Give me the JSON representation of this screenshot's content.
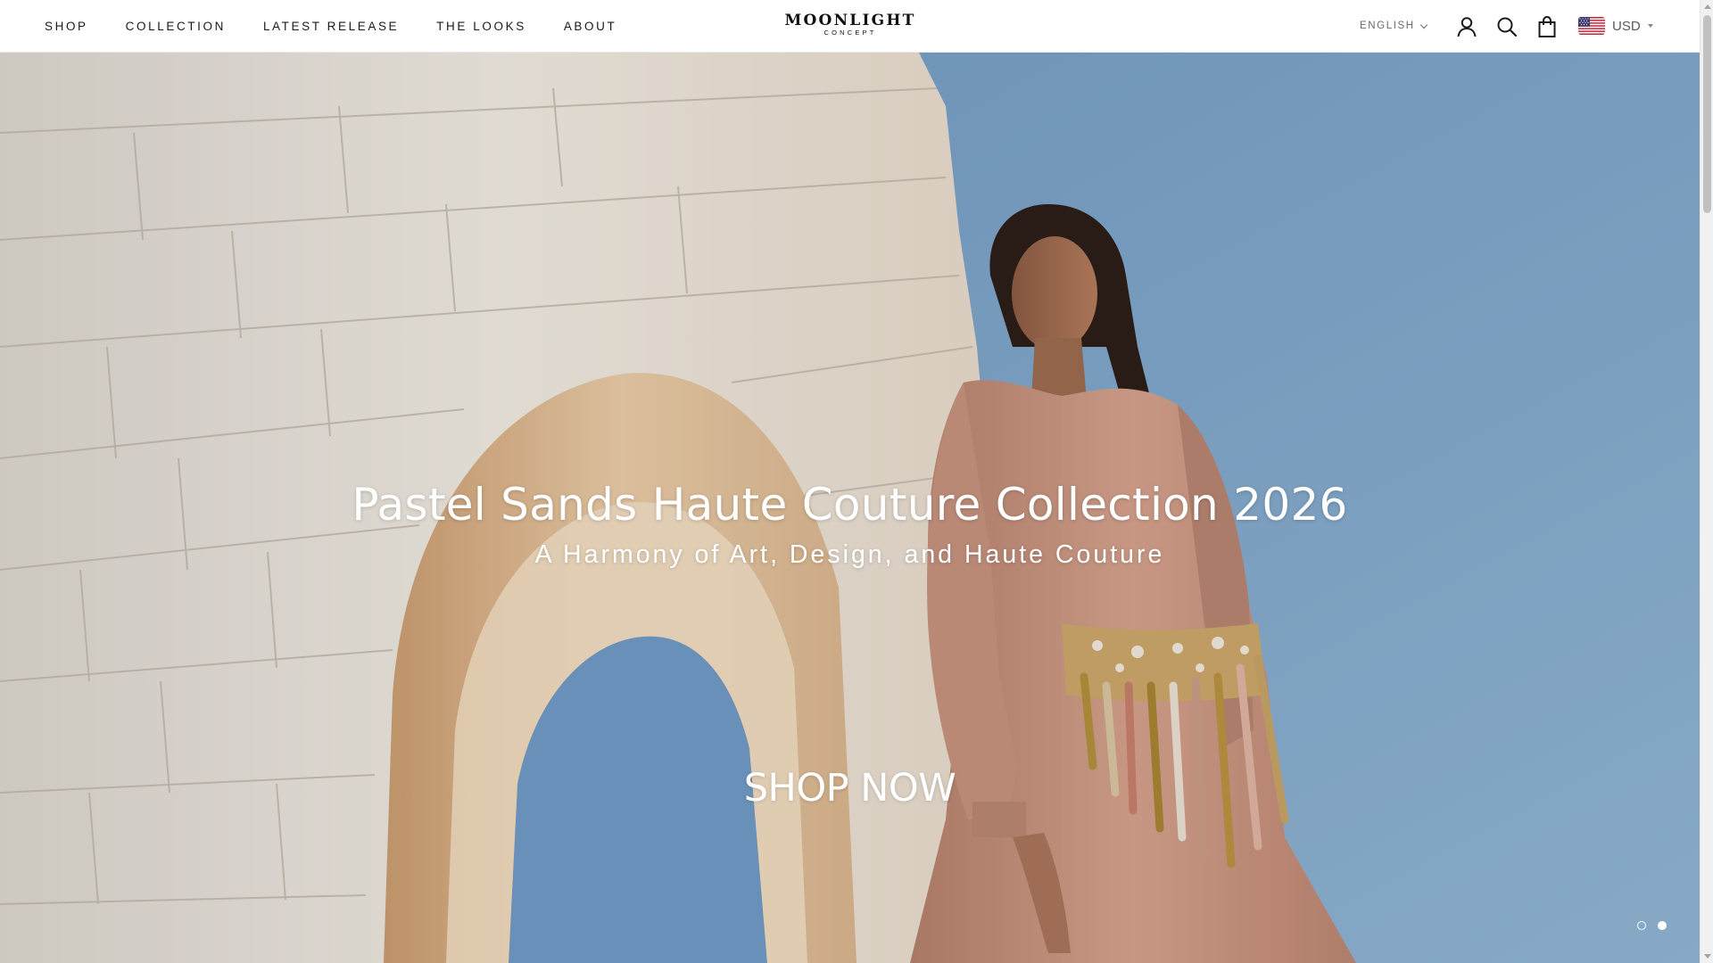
{
  "header": {
    "nav": [
      {
        "label": "SHOP"
      },
      {
        "label": "COLLECTION"
      },
      {
        "label": "LATEST RELEASE"
      },
      {
        "label": "THE LOOKS"
      },
      {
        "label": "ABOUT"
      }
    ],
    "logo": {
      "main": "MOONLIGHT",
      "sub": "CONCEPT"
    },
    "language": "ENGLISH",
    "currency": "USD",
    "icons": [
      "account-icon",
      "search-icon",
      "shopping-bag-icon",
      "us-flag-icon"
    ]
  },
  "hero": {
    "title": "Pastel Sands Haute Couture Collection 2026",
    "subtitle": "A Harmony of Art, Design, and Haute Couture",
    "cta": "SHOP NOW",
    "slides": {
      "count": 2,
      "active_index": 1
    }
  },
  "colors": {
    "sky": "#7fa4c6",
    "stone": "#e9e3d9",
    "dress": "#c4907c",
    "text_dark": "#1c1b1b"
  }
}
